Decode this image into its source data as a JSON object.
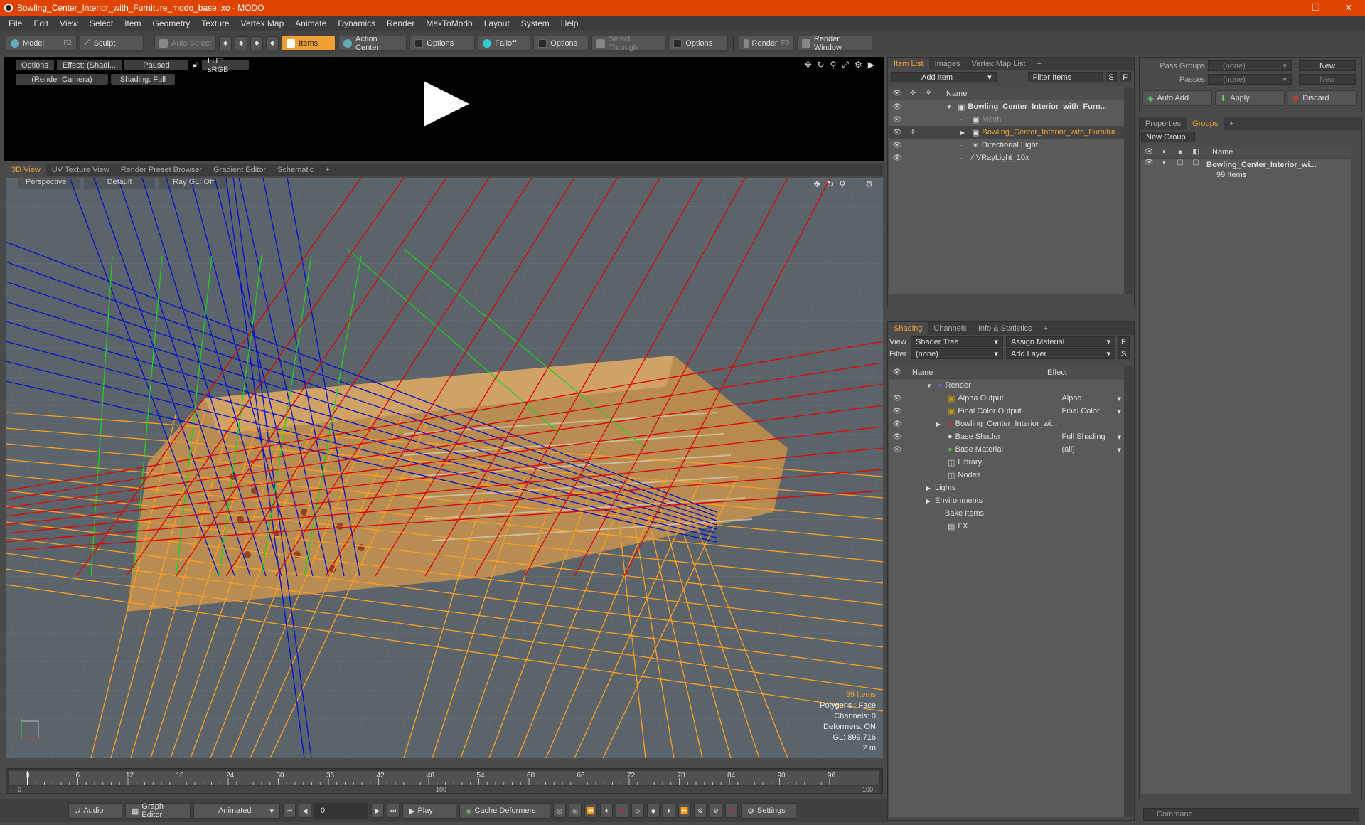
{
  "window": {
    "title": "Bowling_Center_Interior_with_Furniture_modo_base.lxo - MODO",
    "minimize": "—",
    "restore": "❐",
    "close": "✕"
  },
  "menu": [
    "File",
    "Edit",
    "View",
    "Select",
    "Item",
    "Geometry",
    "Texture",
    "Vertex Map",
    "Animate",
    "Dynamics",
    "Render",
    "MaxToModo",
    "Layout",
    "System",
    "Help"
  ],
  "toolbar": {
    "model": "Model",
    "model_key": "F2",
    "sculpt": "Sculpt",
    "auto_select": "Auto Select",
    "items": "Items",
    "action_center": "Action Center",
    "options1": "Options",
    "falloff": "Falloff",
    "options2": "Options",
    "select_through": "Select Through",
    "options3": "Options",
    "render": "Render",
    "render_key": "F9",
    "render_window": "Render Window"
  },
  "preview": {
    "options": "Options",
    "effect": "Effect: (Shadi...",
    "paused": "Paused",
    "lut": "LUT: sRGB",
    "camera": "(Render Camera)",
    "shading": "Shading: Full"
  },
  "view_tabs": [
    "3D View",
    "UV Texture View",
    "Render Preset Browser",
    "Gradient Editor",
    "Schematic",
    "+"
  ],
  "viewport": {
    "perspective": "Perspective",
    "default": "Default",
    "raygl": "Ray GL: Off"
  },
  "stats": {
    "items": "99 Items",
    "polygons": "Polygons : Face",
    "channels": "Channels: 0",
    "deformers": "Deformers: ON",
    "gl": "GL: 899,716",
    "scale": "2 m"
  },
  "timeline": {
    "ticks": [
      "0",
      "6",
      "12",
      "18",
      "24",
      "30",
      "36",
      "42",
      "48",
      "54",
      "60",
      "66",
      "72",
      "78",
      "84",
      "90",
      "96"
    ],
    "bottom_ticks": [
      "0",
      "100",
      "100"
    ]
  },
  "transport": {
    "audio": "Audio",
    "graph_editor": "Graph Editor",
    "animated": "Animated",
    "frame": "0",
    "play": "Play",
    "cache": "Cache Deformers",
    "settings": "Settings"
  },
  "item_list": {
    "tabs": [
      "Item List",
      "Images",
      "Vertex Map List",
      "+"
    ],
    "add_item": "Add Item",
    "filter_items": "Filter Items",
    "s": "S",
    "f": "F",
    "name_col": "Name",
    "rows": [
      {
        "label": "Bowling_Center_Interior_with_Furn...",
        "style": "bold"
      },
      {
        "label": "Mesh",
        "style": "dim"
      },
      {
        "label": "Bowling_Center_Interior_with_Furnitur...",
        "style": "orange"
      },
      {
        "label": "Directional Light",
        "style": "normal"
      },
      {
        "label": "VRayLight_10x",
        "style": "normal"
      }
    ]
  },
  "shading": {
    "tabs": [
      "Shading",
      "Channels",
      "Info & Statistics",
      "+"
    ],
    "view_label": "View",
    "view_value": "Shader Tree",
    "assign": "Assign Material",
    "f": "F",
    "filter_label": "Filter",
    "filter_value": "(none)",
    "add_layer": "Add Layer",
    "s": "S",
    "name_col": "Name",
    "effect_col": "Effect",
    "rows": [
      {
        "label": "Render",
        "effect": ""
      },
      {
        "label": "Alpha Output",
        "effect": "Alpha"
      },
      {
        "label": "Final Color Output",
        "effect": "Final Color"
      },
      {
        "label": "Bowling_Center_Interior_wi...",
        "effect": ""
      },
      {
        "label": "Base Shader",
        "effect": "Full Shading"
      },
      {
        "label": "Base Material",
        "effect": "(all)"
      },
      {
        "label": "Library",
        "effect": ""
      },
      {
        "label": "Nodes",
        "effect": ""
      },
      {
        "label": "Lights",
        "effect": ""
      },
      {
        "label": "Environments",
        "effect": ""
      },
      {
        "label": "Bake Items",
        "effect": ""
      },
      {
        "label": "FX",
        "effect": ""
      }
    ]
  },
  "pass": {
    "pass_groups": "Pass Groups",
    "passes": "Passes",
    "none1": "(none)",
    "none2": "(none)",
    "new1": "New",
    "new2": "New",
    "auto_add": "Auto Add",
    "apply": "Apply",
    "discard": "Discard"
  },
  "groups": {
    "tabs": [
      "Properties",
      "Groups",
      "+"
    ],
    "new_group": "New Group",
    "name_col": "Name",
    "item": "Bowling_Center_Interior_wi...",
    "count": "99 Items"
  },
  "command": {
    "placeholder": "Command"
  },
  "colors": {
    "accent": "#f0a030",
    "titlebar": "#e04300",
    "red": "#e00000",
    "blue": "#0010d0",
    "green": "#20d020",
    "orange": "#ffa020"
  }
}
